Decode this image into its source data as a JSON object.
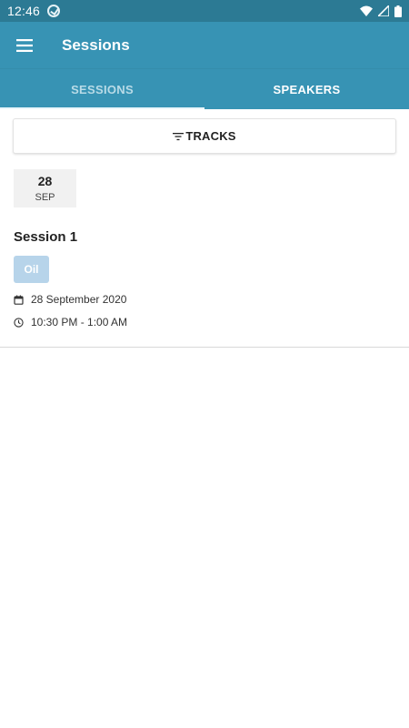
{
  "status_bar": {
    "time": "12:46",
    "left_icon": "sync-icon",
    "right_icons": [
      "wifi-icon",
      "signal-icon",
      "battery-icon"
    ]
  },
  "app_bar": {
    "title": "Sessions",
    "menu_icon": "hamburger-menu-icon",
    "color": "#3793b4"
  },
  "tabs": [
    {
      "label": "SESSIONS",
      "active": false
    },
    {
      "label": "SPEAKERS",
      "active": true
    }
  ],
  "filter": {
    "label": "TRACKS",
    "icon": "filter-icon"
  },
  "date_header": {
    "day": "28",
    "month": "SEP"
  },
  "session": {
    "title": "Session 1",
    "track": "Oil",
    "track_color": "#b7d4ea",
    "date": "28 September 2020",
    "date_icon": "calendar-icon",
    "time": "10:30 PM - 1:00 AM",
    "time_icon": "clock-icon"
  }
}
